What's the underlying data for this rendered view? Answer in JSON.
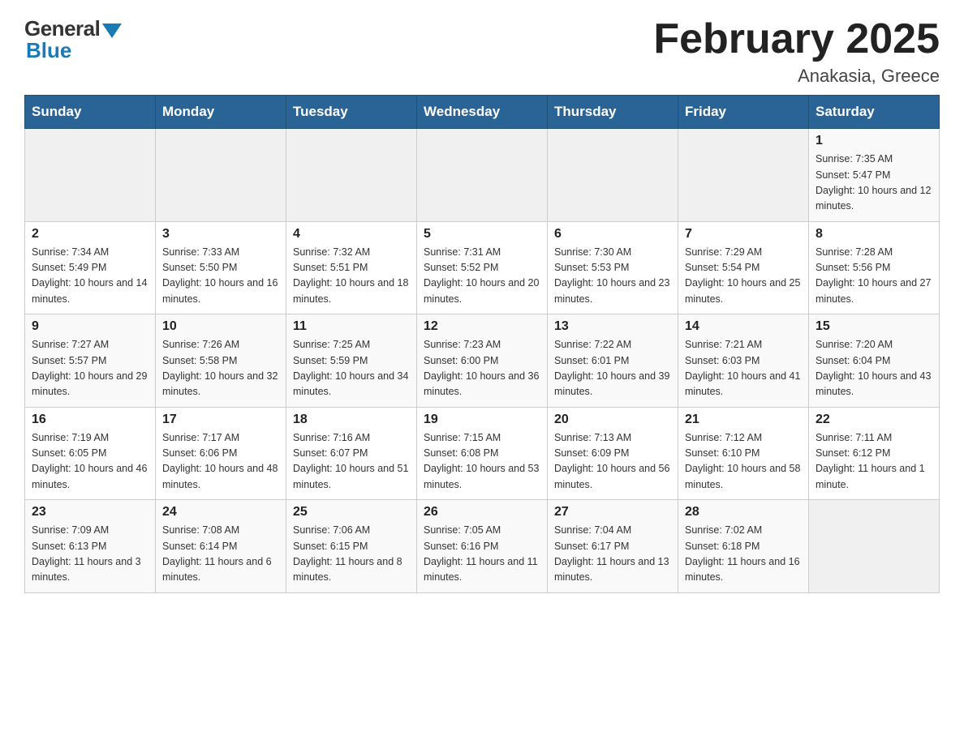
{
  "logo": {
    "general_text": "General",
    "blue_text": "Blue"
  },
  "header": {
    "title": "February 2025",
    "subtitle": "Anakasia, Greece"
  },
  "weekdays": [
    "Sunday",
    "Monday",
    "Tuesday",
    "Wednesday",
    "Thursday",
    "Friday",
    "Saturday"
  ],
  "weeks": [
    [
      {
        "day": "",
        "info": ""
      },
      {
        "day": "",
        "info": ""
      },
      {
        "day": "",
        "info": ""
      },
      {
        "day": "",
        "info": ""
      },
      {
        "day": "",
        "info": ""
      },
      {
        "day": "",
        "info": ""
      },
      {
        "day": "1",
        "info": "Sunrise: 7:35 AM\nSunset: 5:47 PM\nDaylight: 10 hours and 12 minutes."
      }
    ],
    [
      {
        "day": "2",
        "info": "Sunrise: 7:34 AM\nSunset: 5:49 PM\nDaylight: 10 hours and 14 minutes."
      },
      {
        "day": "3",
        "info": "Sunrise: 7:33 AM\nSunset: 5:50 PM\nDaylight: 10 hours and 16 minutes."
      },
      {
        "day": "4",
        "info": "Sunrise: 7:32 AM\nSunset: 5:51 PM\nDaylight: 10 hours and 18 minutes."
      },
      {
        "day": "5",
        "info": "Sunrise: 7:31 AM\nSunset: 5:52 PM\nDaylight: 10 hours and 20 minutes."
      },
      {
        "day": "6",
        "info": "Sunrise: 7:30 AM\nSunset: 5:53 PM\nDaylight: 10 hours and 23 minutes."
      },
      {
        "day": "7",
        "info": "Sunrise: 7:29 AM\nSunset: 5:54 PM\nDaylight: 10 hours and 25 minutes."
      },
      {
        "day": "8",
        "info": "Sunrise: 7:28 AM\nSunset: 5:56 PM\nDaylight: 10 hours and 27 minutes."
      }
    ],
    [
      {
        "day": "9",
        "info": "Sunrise: 7:27 AM\nSunset: 5:57 PM\nDaylight: 10 hours and 29 minutes."
      },
      {
        "day": "10",
        "info": "Sunrise: 7:26 AM\nSunset: 5:58 PM\nDaylight: 10 hours and 32 minutes."
      },
      {
        "day": "11",
        "info": "Sunrise: 7:25 AM\nSunset: 5:59 PM\nDaylight: 10 hours and 34 minutes."
      },
      {
        "day": "12",
        "info": "Sunrise: 7:23 AM\nSunset: 6:00 PM\nDaylight: 10 hours and 36 minutes."
      },
      {
        "day": "13",
        "info": "Sunrise: 7:22 AM\nSunset: 6:01 PM\nDaylight: 10 hours and 39 minutes."
      },
      {
        "day": "14",
        "info": "Sunrise: 7:21 AM\nSunset: 6:03 PM\nDaylight: 10 hours and 41 minutes."
      },
      {
        "day": "15",
        "info": "Sunrise: 7:20 AM\nSunset: 6:04 PM\nDaylight: 10 hours and 43 minutes."
      }
    ],
    [
      {
        "day": "16",
        "info": "Sunrise: 7:19 AM\nSunset: 6:05 PM\nDaylight: 10 hours and 46 minutes."
      },
      {
        "day": "17",
        "info": "Sunrise: 7:17 AM\nSunset: 6:06 PM\nDaylight: 10 hours and 48 minutes."
      },
      {
        "day": "18",
        "info": "Sunrise: 7:16 AM\nSunset: 6:07 PM\nDaylight: 10 hours and 51 minutes."
      },
      {
        "day": "19",
        "info": "Sunrise: 7:15 AM\nSunset: 6:08 PM\nDaylight: 10 hours and 53 minutes."
      },
      {
        "day": "20",
        "info": "Sunrise: 7:13 AM\nSunset: 6:09 PM\nDaylight: 10 hours and 56 minutes."
      },
      {
        "day": "21",
        "info": "Sunrise: 7:12 AM\nSunset: 6:10 PM\nDaylight: 10 hours and 58 minutes."
      },
      {
        "day": "22",
        "info": "Sunrise: 7:11 AM\nSunset: 6:12 PM\nDaylight: 11 hours and 1 minute."
      }
    ],
    [
      {
        "day": "23",
        "info": "Sunrise: 7:09 AM\nSunset: 6:13 PM\nDaylight: 11 hours and 3 minutes."
      },
      {
        "day": "24",
        "info": "Sunrise: 7:08 AM\nSunset: 6:14 PM\nDaylight: 11 hours and 6 minutes."
      },
      {
        "day": "25",
        "info": "Sunrise: 7:06 AM\nSunset: 6:15 PM\nDaylight: 11 hours and 8 minutes."
      },
      {
        "day": "26",
        "info": "Sunrise: 7:05 AM\nSunset: 6:16 PM\nDaylight: 11 hours and 11 minutes."
      },
      {
        "day": "27",
        "info": "Sunrise: 7:04 AM\nSunset: 6:17 PM\nDaylight: 11 hours and 13 minutes."
      },
      {
        "day": "28",
        "info": "Sunrise: 7:02 AM\nSunset: 6:18 PM\nDaylight: 11 hours and 16 minutes."
      },
      {
        "day": "",
        "info": ""
      }
    ]
  ]
}
